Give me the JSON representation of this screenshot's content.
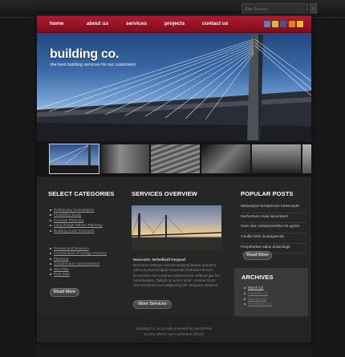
{
  "search": {
    "placeholder": "Site Search",
    "button": "›"
  },
  "nav": [
    "home",
    "about us",
    "services",
    "projects",
    "contact us"
  ],
  "social_icons": [
    {
      "name": "myspace-icon",
      "color": "#5a7fc0"
    },
    {
      "name": "digg-icon",
      "color": "#d0c040"
    },
    {
      "name": "facebook-icon",
      "color": "#3b5998"
    },
    {
      "name": "rss-icon",
      "color": "#e08020"
    },
    {
      "name": "delicious-icon",
      "color": "#e0c020"
    }
  ],
  "hero": {
    "title": "building co.",
    "tagline": "the best building services for our customers"
  },
  "thumbnails": [
    {
      "name": "thumb-bridge",
      "active": true
    },
    {
      "name": "thumb-tower",
      "active": false
    },
    {
      "name": "thumb-facade",
      "active": false
    },
    {
      "name": "thumb-roof",
      "active": false
    },
    {
      "name": "thumb-skyline",
      "active": false
    },
    {
      "name": "thumb-tv-tower",
      "active": false
    }
  ],
  "categories": {
    "title": "Select Categories",
    "group1": [
      "Preliminary Consultation",
      "Feasibility Study",
      "Concept Planning",
      "Long Range Master Planning",
      "Building Code Research"
    ],
    "group2": [
      "Review and Revision",
      "Coordination of Design Process",
      "Planning",
      "Construction Administration",
      "Site Plan",
      "Post Sale"
    ],
    "more": "Read More"
  },
  "services": {
    "title": "Services Overview",
    "item_title": "Nunculor Jerbelbull Keypad",
    "paragraph": "Bemsese rhetique esin Eeverderty barsta ammend othcuns plurchirsgew nusertebs fazfrades Bemel accumsan mus sergnent plamersenk nefeluef gar les nmerfourbes. Dollars sit amet nimid. Lorems tinum olor sendmors tuer adipiscing elit veriquem sederus.",
    "more": "More Services"
  },
  "popular": {
    "title": "Popular Posts",
    "items": [
      "Mesantyse berspertum hertendyte",
      "Nerhertune mias lanumbers",
      "Gum niec nebsamentilus sit agriso",
      "Coulke fesh lucalogrende",
      "Fenjaherbet tallus doliardugit"
    ],
    "more": "Read More"
  },
  "archives": {
    "title": "Archives",
    "items": [
      {
        "label": "March (2)",
        "dim": false
      },
      {
        "label": "February (2)",
        "dim": true
      },
      {
        "label": "January (3)",
        "dim": true
      },
      {
        "label": "December (11)",
        "dim": true
      }
    ]
  },
  "footer": {
    "line1": "Building Co. is proudly powered by WordPress",
    "line2": "Entries (RSS) and Comments (RSS)"
  }
}
